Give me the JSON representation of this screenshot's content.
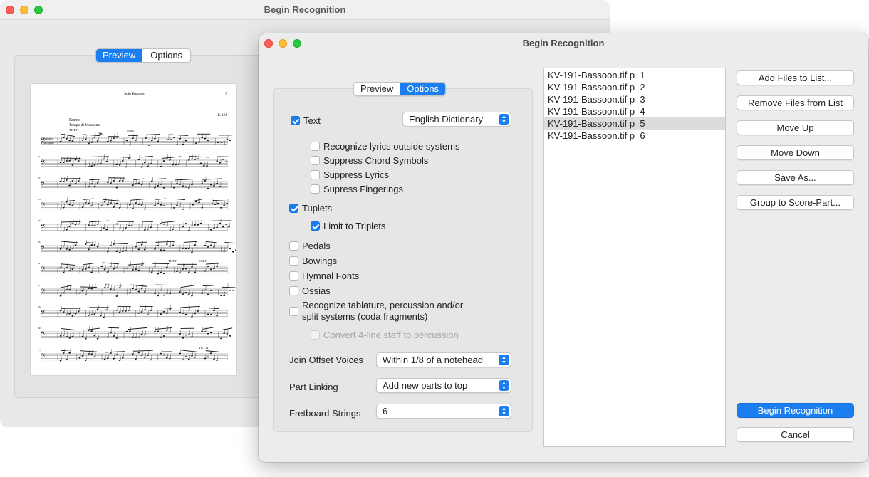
{
  "back_window": {
    "title": "Begin Recognition",
    "tabs": [
      "Preview",
      "Options"
    ],
    "active_tab": "Preview",
    "score": {
      "heading": "Solo Bassoon",
      "page_number": "5",
      "catalog": "K. 191",
      "movement": "Rondo",
      "tempo": "Tempo di Menuetto",
      "tutti_label": "TUTTI",
      "rest_count": "20",
      "solo_label": "SOLO",
      "instrument_line1": "Fagotto",
      "instrument_line2": "Principale",
      "measure_numbers": [
        "21",
        "27",
        "33",
        "39",
        "45",
        "51",
        "57",
        "63",
        "69",
        "75"
      ],
      "rest_count_2": "8",
      "tutti_label_2": "TUTTI",
      "solo_label_2": "SOLO",
      "tutti_label_3": "TUTTI"
    }
  },
  "front_window": {
    "title": "Begin Recognition",
    "tabs": [
      "Preview",
      "Options"
    ],
    "active_tab": "Options",
    "options": {
      "text": {
        "label": "Text",
        "checked": true
      },
      "dictionary": "English Dictionary",
      "recognize_lyrics": {
        "label": "Recognize lyrics outside systems",
        "checked": false
      },
      "suppress_chords": {
        "label": "Suppress Chord Symbols",
        "checked": false
      },
      "suppress_lyrics": {
        "label": "Suppress Lyrics",
        "checked": false
      },
      "supress_fingerings": {
        "label": "Supress Fingerings",
        "checked": false
      },
      "tuplets": {
        "label": "Tuplets",
        "checked": true
      },
      "limit_triplets": {
        "label": "Limit to Triplets",
        "checked": true
      },
      "pedals": {
        "label": "Pedals",
        "checked": false
      },
      "bowings": {
        "label": "Bowings",
        "checked": false
      },
      "hymnal_fonts": {
        "label": "Hymnal Fonts",
        "checked": false
      },
      "ossias": {
        "label": "Ossias",
        "checked": false
      },
      "tablature": {
        "label": "Recognize tablature, percussion and/or split systems (coda fragments)",
        "checked": false
      },
      "convert_4line": {
        "label": "Convert 4-line staff to percussion",
        "checked": false,
        "disabled": true
      },
      "join_offset": {
        "label": "Join Offset Voices",
        "value": "Within 1/8 of a notehead"
      },
      "part_linking": {
        "label": "Part Linking",
        "value": "Add new parts to top"
      },
      "fretboard": {
        "label": "Fretboard Strings",
        "value": "6"
      }
    },
    "files": [
      {
        "name": "KV-191-Bassoon.tif p  1",
        "selected": false
      },
      {
        "name": "KV-191-Bassoon.tif p  2",
        "selected": false
      },
      {
        "name": "KV-191-Bassoon.tif p  3",
        "selected": false
      },
      {
        "name": "KV-191-Bassoon.tif p  4",
        "selected": false
      },
      {
        "name": "KV-191-Bassoon.tif p  5",
        "selected": true
      },
      {
        "name": "KV-191-Bassoon.tif p  6",
        "selected": false
      }
    ],
    "buttons": {
      "add_files": "Add Files to List...",
      "remove_files": "Remove Files from List",
      "move_up": "Move Up",
      "move_down": "Move Down",
      "save_as": "Save As...",
      "group": "Group to Score-Part...",
      "begin": "Begin Recognition",
      "cancel": "Cancel"
    }
  },
  "colors": {
    "accent": "#1a7ef0",
    "selection": "#dcdcdc",
    "window_bg": "#ececec"
  }
}
